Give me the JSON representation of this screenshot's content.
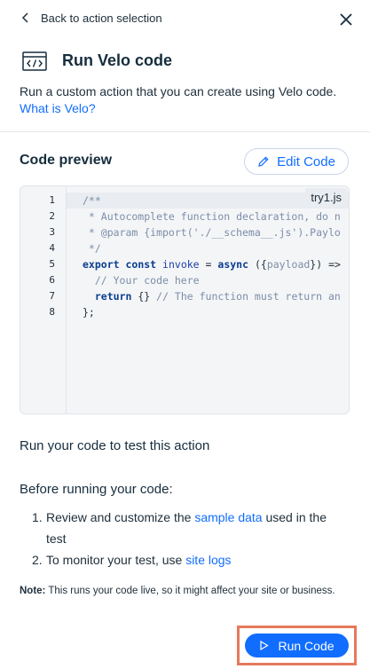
{
  "nav": {
    "back_label": "Back to action selection"
  },
  "header": {
    "title": "Run Velo code",
    "description": "Run a custom action that you can create using Velo code.",
    "link_label": "What is Velo?"
  },
  "code_preview": {
    "heading": "Code preview",
    "edit_label": "Edit Code",
    "file_name": "try1.js",
    "line_numbers": [
      "1",
      "2",
      "3",
      "4",
      "5",
      "6",
      "7",
      "8"
    ],
    "lines": [
      "/**",
      " * Autocomplete function declaration, do n",
      " * @param {import('./__schema__.js').Paylo",
      " */",
      "export const invoke = async ({payload}) =>",
      "  // Your code here",
      "  return {} // The function must return an",
      "};"
    ]
  },
  "run_section": {
    "heading": "Run your code to test this action",
    "before_heading": "Before running your code:",
    "steps": [
      {
        "num": "1.",
        "pre": "Review and customize the ",
        "link": "sample data",
        "post": " used in the test"
      },
      {
        "num": "2.",
        "pre": "To monitor your test, use ",
        "link": "site logs",
        "post": ""
      }
    ],
    "note_label": "Note:",
    "note_text": " This runs your code live, so it might affect your site or business."
  },
  "footer": {
    "run_label": "Run Code"
  },
  "colors": {
    "accent": "#116dff",
    "highlight_border": "#e5795c",
    "text": "#20303c"
  }
}
